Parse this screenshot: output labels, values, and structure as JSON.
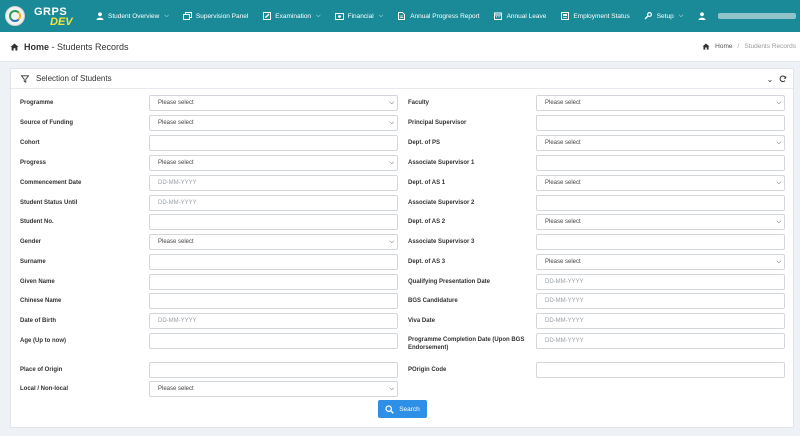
{
  "app": {
    "brand_name": "GRPS",
    "brand_env": "DEV",
    "accent_color": "#1a8a98",
    "env_color": "#f4e23a"
  },
  "nav": [
    {
      "label": "Student Overview",
      "icon": "user-icon",
      "dropdown": true
    },
    {
      "label": "Supervision Panel",
      "icon": "panel-icon",
      "dropdown": false
    },
    {
      "label": "Examination",
      "icon": "edit-icon",
      "dropdown": true
    },
    {
      "label": "Financial",
      "icon": "money-icon",
      "dropdown": true
    },
    {
      "label": "Annual Progress Report",
      "icon": "document-icon",
      "dropdown": false
    },
    {
      "label": "Annual Leave",
      "icon": "calendar-icon",
      "dropdown": false
    },
    {
      "label": "Employment Status",
      "icon": "id-card-icon",
      "dropdown": false
    },
    {
      "label": "Setup",
      "icon": "wrench-icon",
      "dropdown": true
    }
  ],
  "header": {
    "title_main": "Home",
    "title_sub": " - Students Records",
    "breadcrumb_home": "Home",
    "breadcrumb_sep": "/",
    "breadcrumb_current": "Students Records"
  },
  "card": {
    "title": "Selection of Students",
    "collapse_icon": "chevron-down-icon",
    "reload_icon": "refresh-icon"
  },
  "form": {
    "left": [
      {
        "label": "Programme",
        "type": "select",
        "value": "Please select"
      },
      {
        "label": "Source of Funding",
        "type": "select",
        "value": "Please select"
      },
      {
        "label": "Cohort",
        "type": "text",
        "value": ""
      },
      {
        "label": "Progress",
        "type": "select",
        "value": "Please select"
      },
      {
        "label": "Commencement Date",
        "type": "date",
        "value": "DD-MM-YYYY"
      },
      {
        "label": "Student Status Until",
        "type": "date",
        "value": "DD-MM-YYYY"
      },
      {
        "label": "Student No.",
        "type": "text",
        "value": ""
      },
      {
        "label": "Gender",
        "type": "select",
        "value": "Please select"
      },
      {
        "label": "Surname",
        "type": "text",
        "value": ""
      },
      {
        "label": "Given Name",
        "type": "text",
        "value": ""
      },
      {
        "label": "Chinese Name",
        "type": "text",
        "value": ""
      },
      {
        "label": "Date of Birth",
        "type": "date",
        "value": "DD-MM-YYYY"
      },
      {
        "label": "Age (Up to now)",
        "type": "text",
        "value": ""
      },
      {
        "label": "Place of Origin",
        "type": "text",
        "value": ""
      },
      {
        "label": "Local / Non-local",
        "type": "select",
        "value": "Please select"
      }
    ],
    "right": [
      {
        "label": "Faculty",
        "type": "select",
        "value": "Please select"
      },
      {
        "label": "Principal Supervisor",
        "type": "text",
        "value": ""
      },
      {
        "label": "Dept. of PS",
        "type": "select",
        "value": "Please select"
      },
      {
        "label": "Associate Supervisor 1",
        "type": "text",
        "value": ""
      },
      {
        "label": "Dept. of AS 1",
        "type": "select",
        "value": "Please select"
      },
      {
        "label": "Associate Supervisor 2",
        "type": "text",
        "value": ""
      },
      {
        "label": "Dept. of AS 2",
        "type": "select",
        "value": "Please select"
      },
      {
        "label": "Associate Supervisor 3",
        "type": "text",
        "value": ""
      },
      {
        "label": "Dept. of AS 3",
        "type": "select",
        "value": "Please select"
      },
      {
        "label": "Qualifying Presentation Date",
        "type": "date",
        "value": "DD-MM-YYYY"
      },
      {
        "label": "BGS Candidature",
        "type": "date",
        "value": "DD-MM-YYYY"
      },
      {
        "label": "Viva Date",
        "type": "date",
        "value": "DD-MM-YYYY"
      },
      {
        "label": "Programme Completion Date (Upon BGS Endorsement)",
        "type": "date",
        "value": "DD-MM-YYYY"
      },
      {
        "label": "POrigin Code",
        "type": "text",
        "value": ""
      }
    ],
    "search_label": "Search",
    "search_color": "#2e8fe6"
  }
}
